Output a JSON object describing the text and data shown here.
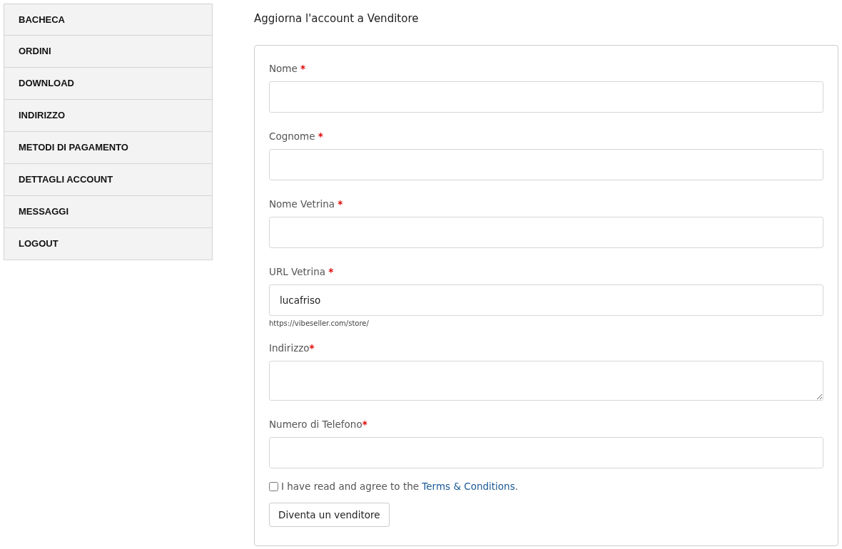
{
  "sidebar": {
    "items": [
      {
        "label": "BACHECA",
        "selected": false
      },
      {
        "label": "ORDINI",
        "selected": false
      },
      {
        "label": "DOWNLOAD",
        "selected": false
      },
      {
        "label": "INDIRIZZO",
        "selected": false
      },
      {
        "label": "METODI DI PAGAMENTO",
        "selected": false
      },
      {
        "label": "DETTAGLI ACCOUNT",
        "selected": false
      },
      {
        "label": "MESSAGGI",
        "selected": false
      },
      {
        "label": "LOGOUT",
        "selected": false
      }
    ]
  },
  "heading": "Aggiorna l'account a Venditore",
  "form": {
    "fields": [
      {
        "kind": "input",
        "label": "Nome ",
        "mark": "*"
      },
      {
        "kind": "input",
        "label": "Cognome ",
        "mark": "*"
      },
      {
        "kind": "input",
        "label": "Nome Vetrina ",
        "mark": "*"
      },
      {
        "kind": "input",
        "label": "URL Vetrina ",
        "mark": "*",
        "value": "lucafriso",
        "help": "https://vibeseller.com/store/"
      },
      {
        "kind": "textarea",
        "label": "Indirizzo",
        "mark": "*"
      },
      {
        "kind": "input",
        "label": "Numero di Telefono",
        "mark": "*"
      }
    ],
    "terms": {
      "checked": false,
      "text_before": "I have read and agree to the ",
      "link": "Terms & Conditions",
      "text_after": "."
    },
    "submit": "Diventa un venditore"
  }
}
